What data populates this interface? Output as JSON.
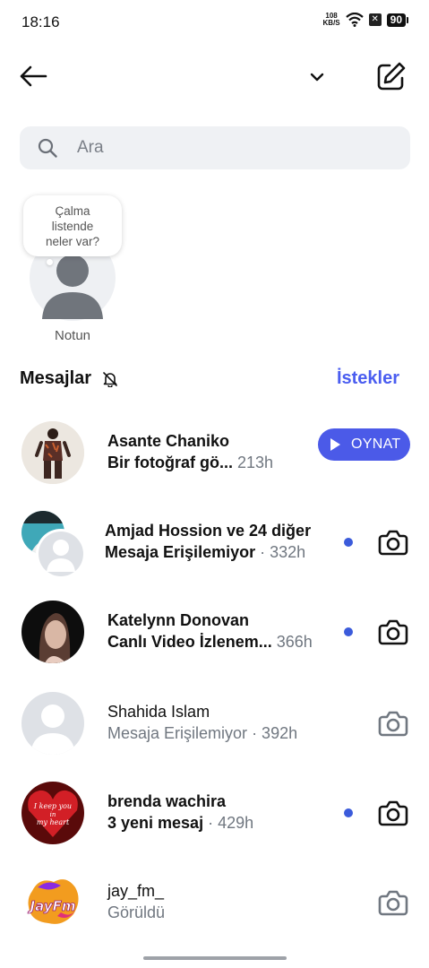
{
  "status_bar": {
    "time": "18:16",
    "net_speed_value": "108",
    "net_speed_unit": "KB/S",
    "battery": "90",
    "icons": [
      "wifi-icon",
      "sim-no-signal-icon",
      "battery-icon"
    ]
  },
  "header": {
    "icons": [
      "back-arrow-icon",
      "chevron-down-icon",
      "compose-icon"
    ]
  },
  "search": {
    "placeholder": "Ara"
  },
  "note": {
    "bubble_line1": "Çalma",
    "bubble_line2": "listende",
    "bubble_line3": "neler var?",
    "label": "Notun"
  },
  "section": {
    "title": "Mesajlar",
    "requests_label": "İstekler"
  },
  "conversations": [
    {
      "name": "Asante Chaniko",
      "subtitle": "Bir fotoğraf gö...",
      "time": "213h",
      "action": "OYNAT",
      "unread": false
    },
    {
      "name": "Amjad Hossion ve 24 diğer",
      "subtitle": "Mesaja Erişilemiyor",
      "time": "· 332h",
      "unread": true
    },
    {
      "name": "Katelynn Donovan",
      "subtitle": "Canlı Video İzlenem...",
      "time": "366h",
      "unread": true
    },
    {
      "name": "Shahida Islam",
      "subtitle": "Mesaja Erişilemiyor",
      "time": "· 392h",
      "unread": false
    },
    {
      "name": "brenda wachira",
      "subtitle": "3 yeni mesaj",
      "time": "· 429h",
      "unread": true,
      "avatar_text_1": "I keep you",
      "avatar_text_2": "in",
      "avatar_text_3": "my heart"
    },
    {
      "name": "jay_fm_",
      "subtitle": "Görüldü",
      "time": "",
      "unread": false,
      "avatar_text": "JayFm"
    }
  ],
  "colors": {
    "accent": "#4b5ae8",
    "unread_dot": "#3b5bdb",
    "search_bg": "#eff1f4"
  }
}
